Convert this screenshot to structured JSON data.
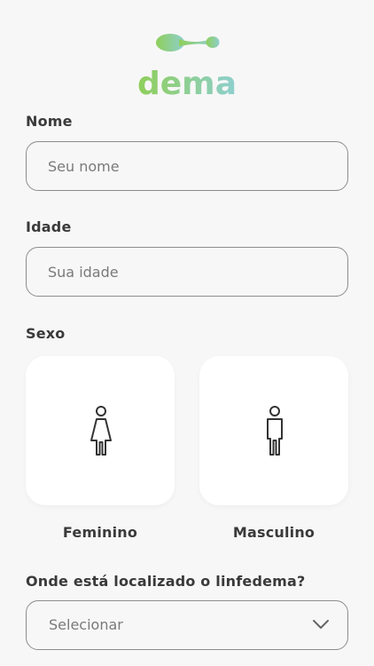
{
  "brand": {
    "name": "dema",
    "gradient_start": "#8fcf5a",
    "gradient_end": "#8ecfcf"
  },
  "form": {
    "name": {
      "label": "Nome",
      "placeholder": "Seu nome",
      "value": ""
    },
    "age": {
      "label": "Idade",
      "placeholder": "Sua idade",
      "value": ""
    },
    "sex": {
      "label": "Sexo",
      "options": [
        {
          "label": "Feminino",
          "icon": "female-figure-icon"
        },
        {
          "label": "Masculino",
          "icon": "male-figure-icon"
        }
      ]
    },
    "location": {
      "label": "Onde está localizado o linfedema?",
      "selected": "Selecionar",
      "icon": "chevron-down-icon"
    }
  },
  "colors": {
    "background": "#f7f7f7",
    "card": "#ffffff",
    "border": "#8d8d8d",
    "label_text": "#3a3a3a",
    "placeholder_text": "#7a7a7a"
  }
}
